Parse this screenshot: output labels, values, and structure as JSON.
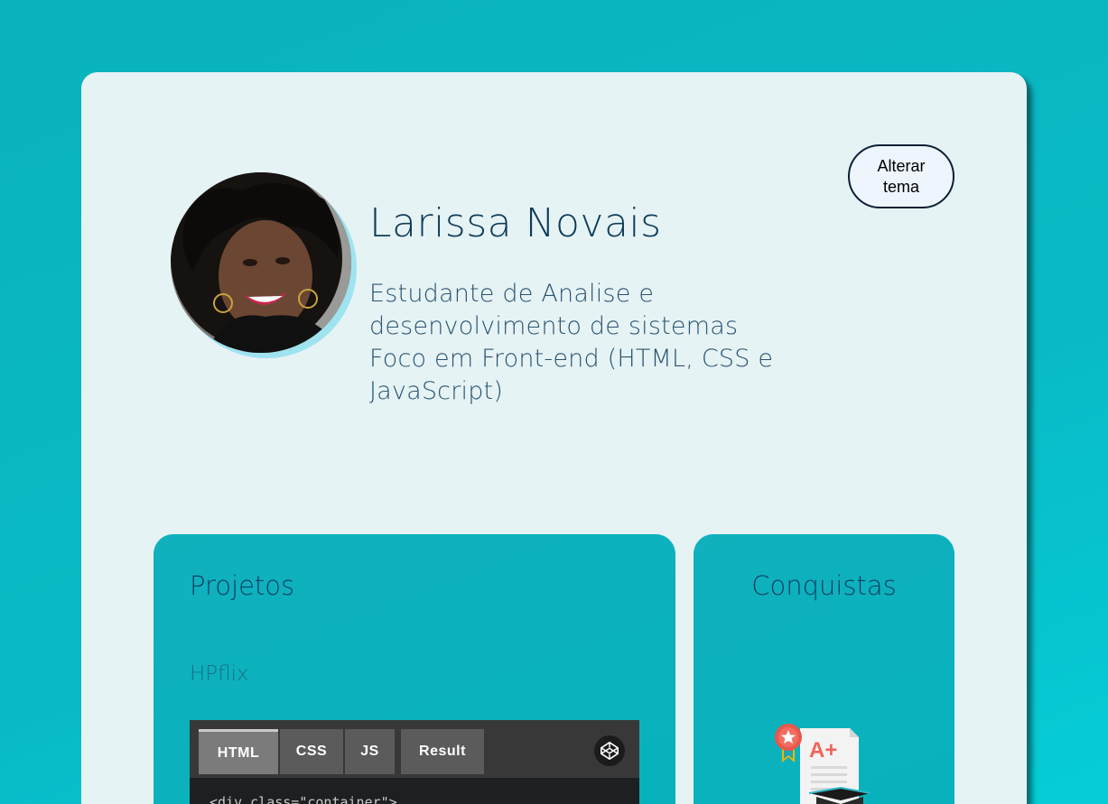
{
  "theme_button": {
    "label": "Alterar tema"
  },
  "profile": {
    "name": "Larissa Novais",
    "bio_lines": [
      "Estudante de Analise e",
      "desenvolvimento de sistemas",
      "Foco em Front-end (HTML, CSS e",
      "JavaScript)"
    ]
  },
  "projects": {
    "title": "Projetos",
    "items": [
      {
        "name": "HPflix",
        "embed": {
          "tabs": [
            "HTML",
            "CSS",
            "JS",
            "Result"
          ],
          "active_tab": "HTML",
          "code_preview": "<div class=\"container\">"
        }
      }
    ]
  },
  "achievements": {
    "title": "Conquistas",
    "badge_icon": "certificate-a-plus-icon",
    "badge_text": "A+"
  },
  "colors": {
    "background": "#08bac6",
    "card": "#e6f3f5",
    "panel": "#0bb1bd",
    "name_text": "#0f3b57"
  }
}
